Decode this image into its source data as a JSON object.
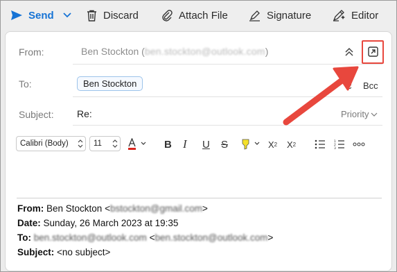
{
  "toolbar": {
    "send_label": "Send",
    "discard_label": "Discard",
    "attach_label": "Attach File",
    "signature_label": "Signature",
    "editor_label": "Editor"
  },
  "header": {
    "from_label": "From:",
    "from_name": "Ben Stockton (",
    "from_email_obscured": "ben.stockton@outlook.com",
    "from_close": ")",
    "to_label": "To:",
    "to_recipient": "Ben Stockton",
    "cc_label": "c",
    "bcc_label": "Bcc",
    "subject_label": "Subject:",
    "subject_value": "Re:",
    "priority_label": "Priority"
  },
  "format_bar": {
    "font_name": "Calibri (Body)",
    "font_size": "11",
    "text_color_hex": "#d9251d",
    "highlight_color_hex": "#f5e12a"
  },
  "reply": {
    "from_key": "From:",
    "from_value": "Ben Stockton <",
    "from_email_obscured": "bstockton@gmail.com",
    "from_close": ">",
    "date_key": "Date:",
    "date_value": "Sunday, 26 March 2023 at 19:35",
    "to_key": "To:",
    "to_email_obscured": "ben.stockton@outlook.com",
    "to_middle": " <",
    "to_email2_obscured": "ben.stockton@outlook.com",
    "to_close": ">",
    "subject_key": "Subject:",
    "subject_value": "<no subject>"
  },
  "colors": {
    "accent": "#1673d5",
    "annotation": "#e8473d"
  }
}
